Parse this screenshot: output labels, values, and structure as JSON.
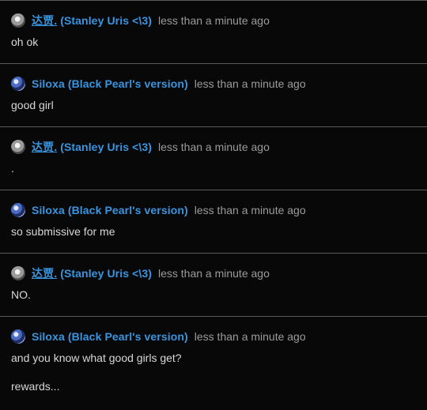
{
  "messages": [
    {
      "avatar_icon": "gray-profile-avatar",
      "username_cn": "达贾.",
      "username_rest": " (Stanley Uris <\\3)",
      "timestamp": "less than a minute ago",
      "lines": [
        "oh ok"
      ]
    },
    {
      "avatar_icon": "blue-profile-avatar",
      "username_cn": "",
      "username_rest": "Siloxa (Black Pearl's version)",
      "timestamp": "less than a minute ago",
      "lines": [
        "good girl"
      ]
    },
    {
      "avatar_icon": "gray-profile-avatar",
      "username_cn": "达贾.",
      "username_rest": " (Stanley Uris <\\3)",
      "timestamp": "less than a minute ago",
      "lines": [
        "."
      ]
    },
    {
      "avatar_icon": "blue-profile-avatar",
      "username_cn": "",
      "username_rest": "Siloxa (Black Pearl's version)",
      "timestamp": "less than a minute ago",
      "lines": [
        "so submissive for me"
      ]
    },
    {
      "avatar_icon": "gray-profile-avatar",
      "username_cn": "达贾.",
      "username_rest": " (Stanley Uris <\\3)",
      "timestamp": "less than a minute ago",
      "lines": [
        "NO."
      ]
    },
    {
      "avatar_icon": "blue-profile-avatar",
      "username_cn": "",
      "username_rest": "Siloxa (Black Pearl's version)",
      "timestamp": "less than a minute ago",
      "lines": [
        "and you know what good girls get?",
        "rewards..."
      ]
    }
  ],
  "colors": {
    "background": "#080808",
    "username": "#3a95e0",
    "timestamp": "#9b9b9b",
    "text": "#d8d8d8",
    "divider": "#5a5a5a"
  }
}
